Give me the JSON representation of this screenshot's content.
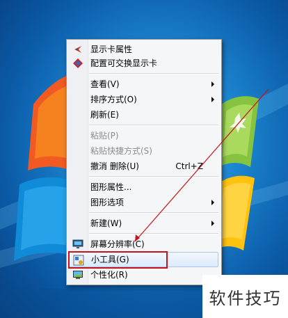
{
  "menu": {
    "items": [
      {
        "label": "显示卡属性",
        "icon": "graphics-card-icon"
      },
      {
        "label": "配置可交换显示卡",
        "icon": "switchable-graphics-icon"
      },
      {
        "label": "查看(V)",
        "submenu": true
      },
      {
        "label": "排序方式(O)",
        "submenu": true
      },
      {
        "label": "刷新(E)"
      },
      {
        "label": "粘贴(P)",
        "disabled": true
      },
      {
        "label": "粘贴快捷方式(S)",
        "disabled": true
      },
      {
        "label": "撤消 删除(U)",
        "shortcut": "Ctrl+Z"
      },
      {
        "label": "图形属性..."
      },
      {
        "label": "图形选项",
        "submenu": true
      },
      {
        "label": "新建(W)",
        "submenu": true
      },
      {
        "label": "屏幕分辨率(C)",
        "icon": "screen-resolution-icon"
      },
      {
        "label": "小工具(G)",
        "icon": "gadgets-icon",
        "highlighted": true
      },
      {
        "label": "个性化(R)",
        "icon": "personalize-icon"
      }
    ]
  },
  "watermark": "软件技巧",
  "colors": {
    "annotation_red": "#c8121b",
    "desktop_blue": "#1d86d1",
    "highlight": "#dceafb"
  }
}
